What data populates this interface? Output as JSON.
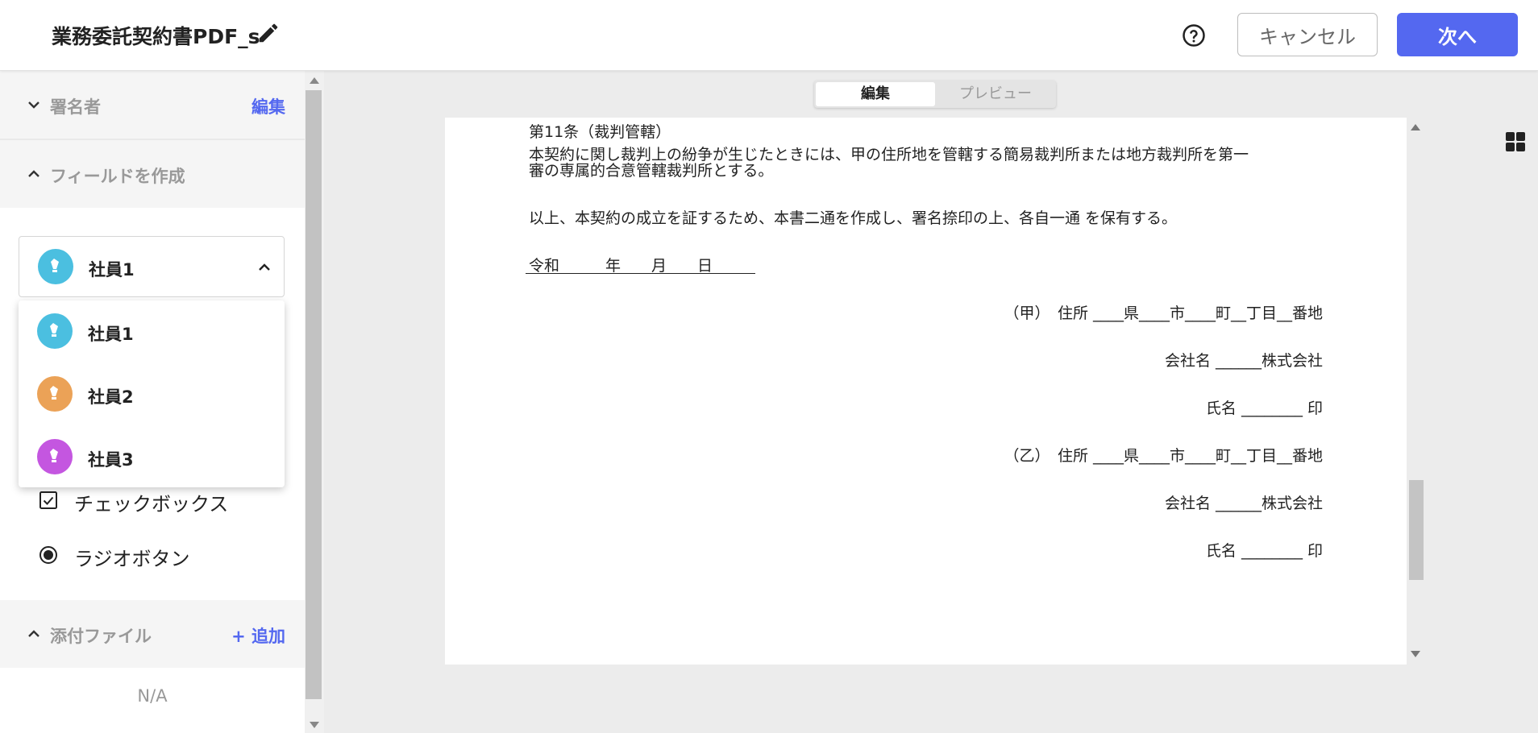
{
  "header": {
    "title": "業務委託契約書PDF_s",
    "cancel_label": "キャンセル",
    "next_label": "次へ"
  },
  "sidebar": {
    "signers": {
      "label": "署名者",
      "action": "編集"
    },
    "fields": {
      "label": "フィールドを作成"
    },
    "selected_signer": "社員1",
    "field_types": [
      {
        "label": "チェックボックス",
        "icon": "checkbox-icon"
      },
      {
        "label": "ラジオボタン",
        "icon": "radio-button-icon"
      }
    ],
    "attachments": {
      "label": "添付ファイル",
      "action": "+ 追加",
      "empty_text": "N/A"
    }
  },
  "dropdown": {
    "options": [
      {
        "label": "社員1",
        "color": "#4bbfe0"
      },
      {
        "label": "社員2",
        "color": "#eba257"
      },
      {
        "label": "社員3",
        "color": "#c456e0"
      }
    ]
  },
  "tabs": [
    {
      "label": "編集",
      "active": true
    },
    {
      "label": "プレビュー",
      "active": false
    }
  ],
  "document": {
    "article_title": "第11条（裁判管轄）",
    "article_line1": "本契約に関し裁判上の紛争が生じたときには、甲の住所地を管轄する簡易裁判所または地方裁判所を第一",
    "article_line2": "審の専属的合意管轄裁判所とする。",
    "closing": "以上、本契約の成立を証するため、本書二通を作成し、署名捺印の上、各自一通 を保有する。",
    "date_line": "令和　　　年　　月　　日",
    "party_a_address": "（甲）　住所 ____県____市____町__丁目__番地",
    "party_a_company": "会社名 ______株式会社",
    "party_a_name": "氏名 ________ 印",
    "party_b_address": "（乙）　住所 ____県____市____町__丁目__番地",
    "party_b_company": "会社名 ______株式会社",
    "party_b_name": "氏名 ________ 印"
  },
  "colors": {
    "accent": "#5468f0",
    "signer1": "#4bbfe0",
    "signer2": "#eba257",
    "signer3": "#c456e0"
  }
}
